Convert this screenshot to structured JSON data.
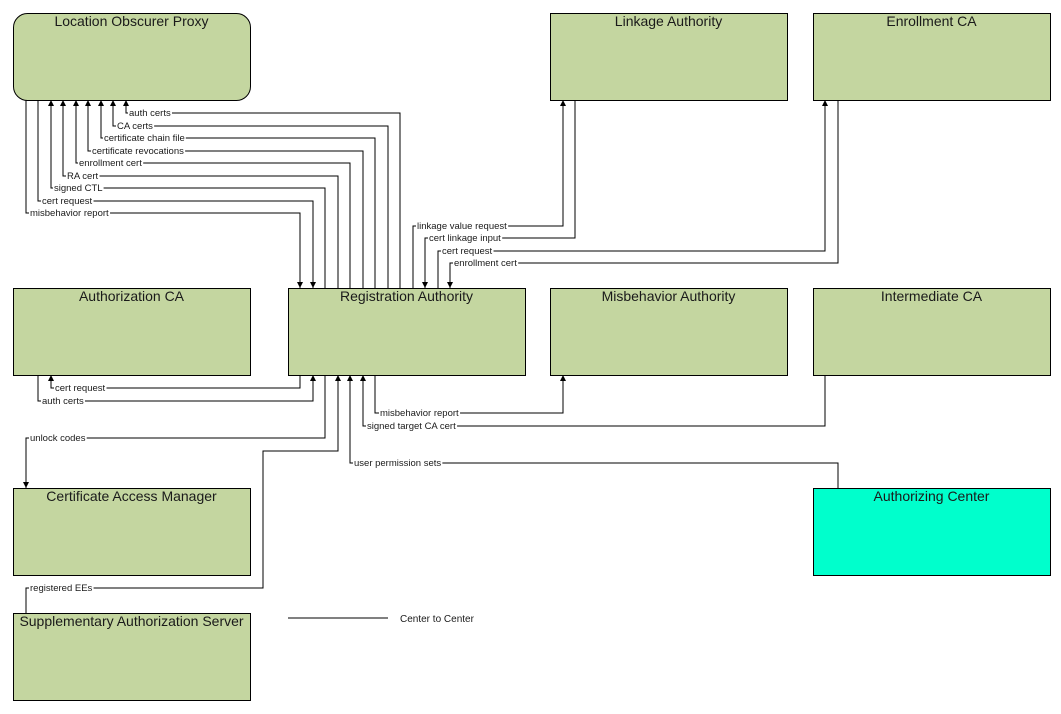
{
  "diagram": {
    "colors": {
      "node_fill": "#C4D6A0",
      "highlight_fill": "#00FFCC",
      "stroke": "#000000"
    },
    "nodes": [
      {
        "id": "lop",
        "title": "Location Obscurer Proxy",
        "rounded": true,
        "highlight": false
      },
      {
        "id": "la",
        "title": "Linkage Authority",
        "rounded": false,
        "highlight": false
      },
      {
        "id": "eca",
        "title": "Enrollment CA",
        "rounded": false,
        "highlight": false
      },
      {
        "id": "aca",
        "title": "Authorization CA",
        "rounded": false,
        "highlight": false
      },
      {
        "id": "ra",
        "title": "Registration Authority",
        "rounded": false,
        "highlight": false
      },
      {
        "id": "ma",
        "title": "Misbehavior Authority",
        "rounded": false,
        "highlight": false
      },
      {
        "id": "ica",
        "title": "Intermediate CA",
        "rounded": false,
        "highlight": false
      },
      {
        "id": "cam",
        "title": "Certificate Access Manager",
        "rounded": false,
        "highlight": false
      },
      {
        "id": "ac",
        "title": "Authorizing Center",
        "rounded": false,
        "highlight": true
      },
      {
        "id": "sas",
        "title": "Supplementary Authorization Server",
        "rounded": false,
        "highlight": false
      }
    ],
    "flows": [
      {
        "id": "auth-certs-lop",
        "label": "auth certs",
        "from": "ra",
        "to": "lop"
      },
      {
        "id": "ca-certs",
        "label": "CA certs",
        "from": "ra",
        "to": "lop"
      },
      {
        "id": "certificate-chain-file",
        "label": "certificate chain file",
        "from": "ra",
        "to": "lop"
      },
      {
        "id": "certificate-revocations",
        "label": "certificate revocations",
        "from": "ra",
        "to": "lop"
      },
      {
        "id": "enrollment-cert-lop",
        "label": "enrollment cert",
        "from": "ra",
        "to": "lop"
      },
      {
        "id": "ra-cert",
        "label": "RA cert",
        "from": "ra",
        "to": "lop"
      },
      {
        "id": "signed-ctl",
        "label": "signed CTL",
        "from": "ra",
        "to": "lop"
      },
      {
        "id": "cert-request-lop",
        "label": "cert request",
        "from": "lop",
        "to": "ra"
      },
      {
        "id": "misbehavior-report-lop",
        "label": "misbehavior report",
        "from": "lop",
        "to": "ra"
      },
      {
        "id": "linkage-value-request",
        "label": "linkage value request",
        "from": "ra",
        "to": "la"
      },
      {
        "id": "cert-linkage-input",
        "label": "cert linkage input",
        "from": "la",
        "to": "ra"
      },
      {
        "id": "cert-request-eca",
        "label": "cert request",
        "from": "ra",
        "to": "eca"
      },
      {
        "id": "enrollment-cert-eca",
        "label": "enrollment cert",
        "from": "eca",
        "to": "ra"
      },
      {
        "id": "cert-request-aca",
        "label": "cert request",
        "from": "ra",
        "to": "aca"
      },
      {
        "id": "auth-certs-aca",
        "label": "auth certs",
        "from": "aca",
        "to": "ra"
      },
      {
        "id": "misbehavior-report-ma",
        "label": "misbehavior report",
        "from": "ra",
        "to": "ma"
      },
      {
        "id": "signed-target-ca-cert",
        "label": "signed target CA cert",
        "from": "ica",
        "to": "ra"
      },
      {
        "id": "unlock-codes",
        "label": "unlock codes",
        "from": "ra",
        "to": "cam"
      },
      {
        "id": "user-permission-sets",
        "label": "user permission sets",
        "from": "ac",
        "to": "ra"
      },
      {
        "id": "registered-ees",
        "label": "registered EEs",
        "from": "sas",
        "to": "ra"
      }
    ],
    "legend": {
      "label": "Center to Center"
    }
  }
}
